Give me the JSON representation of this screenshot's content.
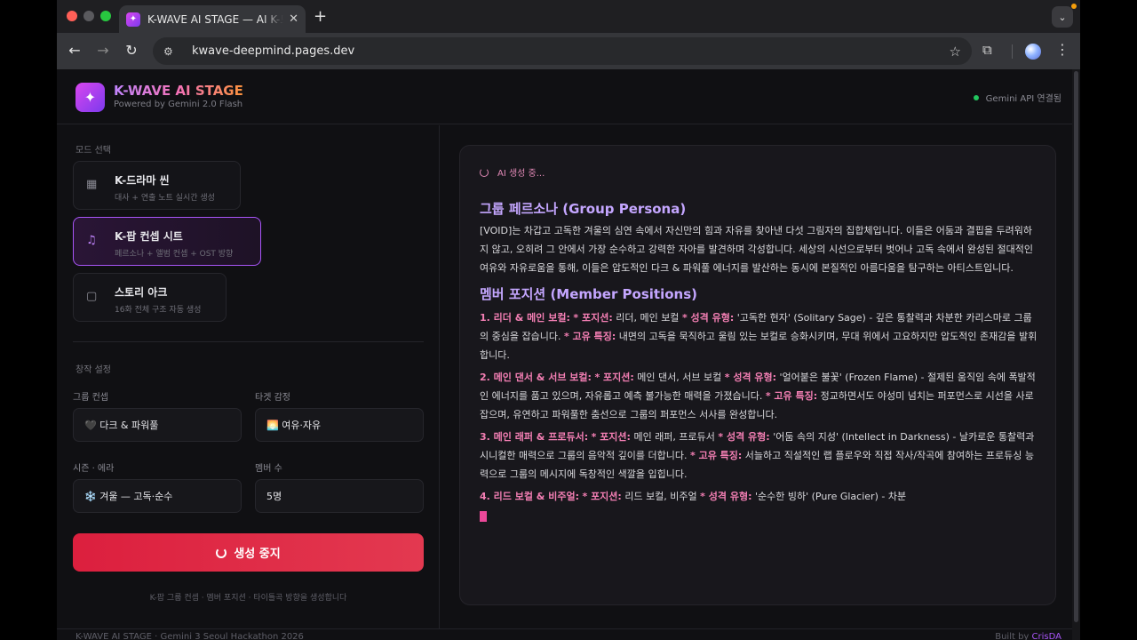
{
  "browser": {
    "tab_title": "K-WAVE AI STAGE — AI K-드라마",
    "tab_favicon": "✦",
    "tab_close": "✕",
    "new_tab": "+",
    "tab_menu": "⌄",
    "url": "kwave-deepmind.pages.dev",
    "icons": {
      "back": "←",
      "forward": "→",
      "reload": "↻",
      "site_info": "⚙",
      "star": "☆",
      "extensions": "⧉",
      "menu": "⋮"
    }
  },
  "header": {
    "logo_icon": "✦",
    "title": "K-WAVE AI STAGE",
    "subtitle": "Powered by Gemini 2.0 Flash",
    "api_status": "Gemini API 연결됨",
    "api_status_color": "#22c55e"
  },
  "sidebar": {
    "mode_label": "모드 선택",
    "modes": [
      {
        "icon": "▦",
        "title": "K-드라마 씬",
        "desc": "대사 + 연출 노트 실시간 생성"
      },
      {
        "icon": "♫",
        "title": "K-팝 컨셉 시트",
        "desc": "페르소나 + 앨범 컨셉 + OST 방향"
      },
      {
        "icon": "▢",
        "title": "스토리 아크",
        "desc": "16화 전체 구조 자동 생성"
      }
    ],
    "settings_label": "창작 설정",
    "fields": {
      "group_concept": {
        "label": "그룹 컨셉",
        "value": "🖤 다크 & 파워풀"
      },
      "target_emotion": {
        "label": "타겟 감정",
        "value": "🌅 여유·자유"
      },
      "season_era": {
        "label": "시즌 · 에라",
        "value": "❄️ 겨울 — 고독·순수"
      },
      "member_count": {
        "label": "멤버 수",
        "value": "5명"
      }
    },
    "stop_button": "생성 중지",
    "hint": "K-팝 그룹 컨셉 · 멤버 포지션 · 타이틀곡 방향을 생성합니다"
  },
  "output": {
    "status": "AI 생성 중...",
    "persona_heading": "그룹 페르소나 (Group Persona)",
    "persona_text": "[VOID]는 차갑고 고독한 겨울의 심연 속에서 자신만의 힘과 자유를 찾아낸 다섯 그림자의 집합체입니다. 이들은 어둠과 결핍을 두려워하지 않고, 오히려 그 안에서 가장 순수하고 강력한 자아를 발견하며 각성합니다. 세상의 시선으로부터 벗어나 고독 속에서 완성된 절대적인 여유와 자유로움을 통해, 이들은 압도적인 다크 & 파워풀 에너지를 발산하는 동시에 본질적인 아름다움을 탐구하는 아티스트입니다.",
    "members_heading": "멤버 포지션 (Member Positions)",
    "members": [
      {
        "name": "1. 리더 & 메인 보컬:",
        "pos_label": "* 포지션:",
        "pos": "리더, 메인 보컬",
        "type_label": "* 성격 유형:",
        "type": "'고독한 현자' (Solitary Sage) - 깊은 통찰력과 차분한 카리스마로 그룹의 중심을 잡습니다.",
        "trait_label": "* 고유 특징:",
        "trait": "내면의 고독을 묵직하고 울림 있는 보컬로 승화시키며, 무대 위에서 고요하지만 압도적인 존재감을 발휘합니다."
      },
      {
        "name": "2. 메인 댄서 & 서브 보컬:",
        "pos_label": "* 포지션:",
        "pos": "메인 댄서, 서브 보컬",
        "type_label": "* 성격 유형:",
        "type": "'얼어붙은 불꽃' (Frozen Flame) - 절제된 움직임 속에 폭발적인 에너지를 품고 있으며, 자유롭고 예측 불가능한 매력을 가졌습니다.",
        "trait_label": "* 고유 특징:",
        "trait": "정교하면서도 야성미 넘치는 퍼포먼스로 시선을 사로잡으며, 유연하고 파워풀한 춤선으로 그룹의 퍼포먼스 서사를 완성합니다."
      },
      {
        "name": "3. 메인 래퍼 & 프로듀서:",
        "pos_label": "* 포지션:",
        "pos": "메인 래퍼, 프로듀서",
        "type_label": "* 성격 유형:",
        "type": "'어둠 속의 지성' (Intellect in Darkness) - 날카로운 통찰력과 시니컬한 매력으로 그룹의 음악적 깊이를 더합니다.",
        "trait_label": "* 고유 특징:",
        "trait": "서늘하고 직설적인 랩 플로우와 직접 작사/작곡에 참여하는 프로듀싱 능력으로 그룹의 메시지에 독창적인 색깔을 입힙니다."
      },
      {
        "name": "4. 리드 보컬 & 비주얼:",
        "pos_label": "* 포지션:",
        "pos": "리드 보컬, 비주얼",
        "type_label": "* 성격 유형:",
        "type": "'순수한 빙하' (Pure Glacier) - 차분",
        "trait_label": "",
        "trait": ""
      }
    ]
  },
  "footer": {
    "left": "K-WAVE AI STAGE · Gemini 3 Seoul Hackathon 2026",
    "right_prefix": "Built by",
    "right_link": "CrisDA"
  }
}
